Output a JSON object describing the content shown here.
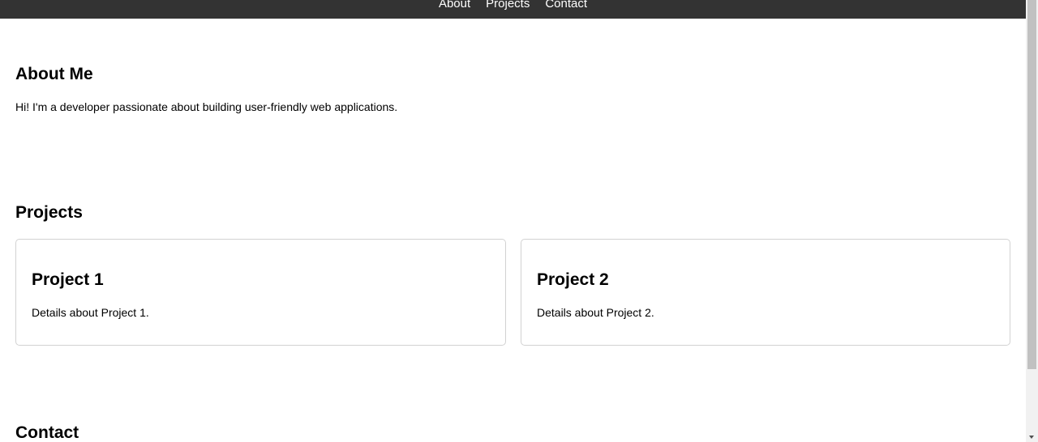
{
  "nav": {
    "links": [
      "About",
      "Projects",
      "Contact"
    ]
  },
  "about": {
    "title": "About Me",
    "text": "Hi! I'm a developer passionate about building user-friendly web applications."
  },
  "projects": {
    "title": "Projects",
    "items": [
      {
        "title": "Project 1",
        "details": "Details about Project 1."
      },
      {
        "title": "Project 2",
        "details": "Details about Project 2."
      }
    ]
  },
  "contact": {
    "title": "Contact"
  },
  "colors": {
    "navbar_background": "#333333",
    "nav_text": "#ffffff",
    "card_border": "#d2d2d2",
    "scrollbar_track": "#f1f1f1",
    "scrollbar_thumb": "#c1c1c1"
  }
}
